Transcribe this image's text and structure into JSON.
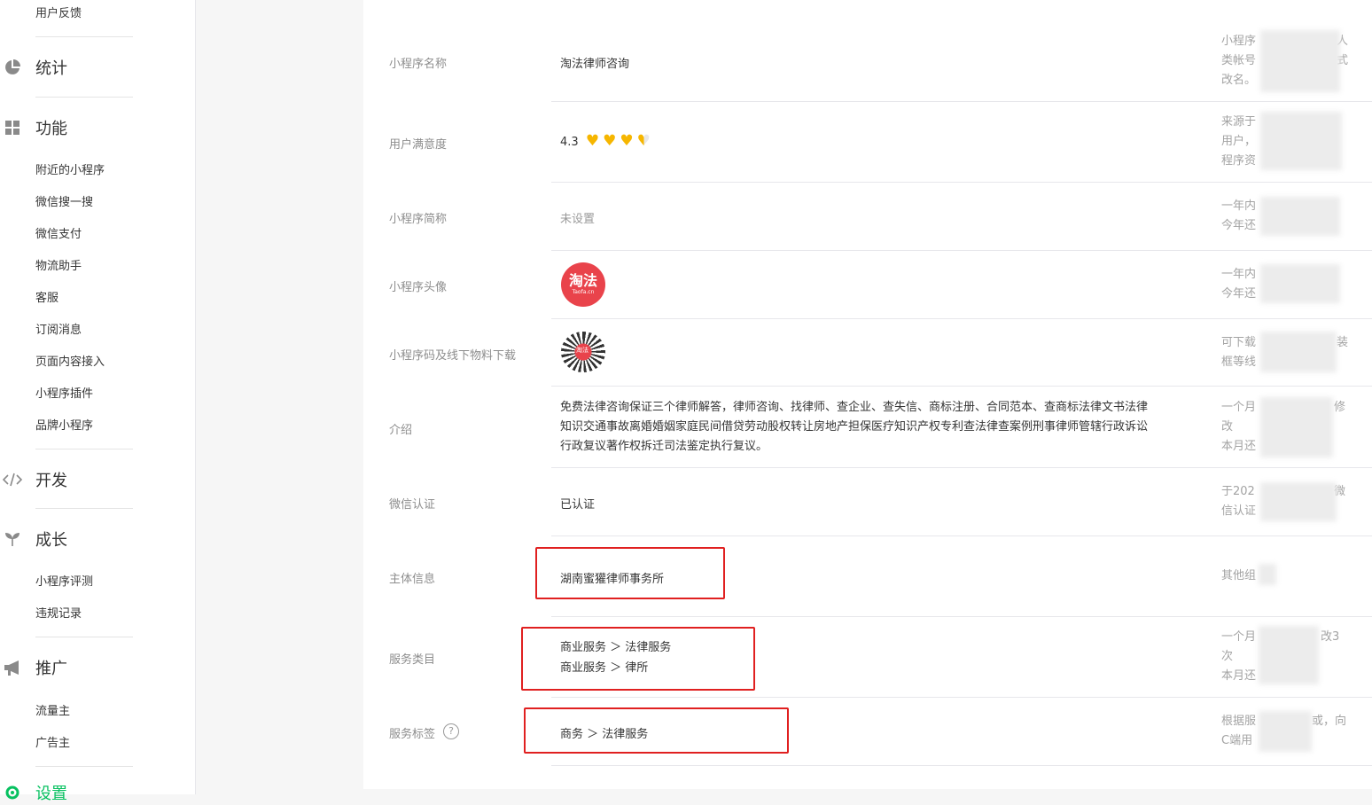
{
  "sidebar": {
    "feedback": "用户反馈",
    "stats": {
      "icon": "pie-chart-icon",
      "label": "统计"
    },
    "features": {
      "icon": "grid-icon",
      "label": "功能",
      "items": [
        "附近的小程序",
        "微信搜一搜",
        "微信支付",
        "物流助手",
        "客服",
        "订阅消息",
        "页面内容接入",
        "小程序插件",
        "品牌小程序"
      ]
    },
    "dev": {
      "icon": "code-icon",
      "label": "开发"
    },
    "growth": {
      "icon": "sprout-icon",
      "label": "成长",
      "items": [
        "小程序评测",
        "违规记录"
      ]
    },
    "promo": {
      "icon": "megaphone-icon",
      "label": "推广",
      "items": [
        "流量主",
        "广告主"
      ]
    },
    "settings": {
      "icon": "gear-icon",
      "label": "设置"
    }
  },
  "fields": {
    "name": {
      "label": "小程序名称",
      "value": "淘法律师咨询",
      "note": [
        "小程序",
        "类帐号",
        "改名。"
      ],
      "note_tail": [
        "人",
        "式"
      ]
    },
    "rating": {
      "label": "用户满意度",
      "value": "4.3",
      "stars": 3.5,
      "note": [
        "来源于",
        "用户，",
        "程序资"
      ]
    },
    "short": {
      "label": "小程序简称",
      "value": "未设置",
      "note": [
        "一年内",
        "今年还"
      ]
    },
    "avatar": {
      "label": "小程序头像",
      "logo_text": "淘法",
      "logo_sub": "Taofa.cn",
      "note": [
        "一年内",
        "今年还"
      ]
    },
    "qr": {
      "label": "小程序码及线下物料下载",
      "logo_text": "淘法",
      "note": [
        "可下载",
        "框等线"
      ],
      "note_tail": "装"
    },
    "intro": {
      "label": "介绍",
      "lines": [
        "免费法律咨询保证三个律师解答，律师咨询、找律师、查企业、查失信、商标注册、合同范本、查商标法律文书法律",
        "知识交通事故离婚婚姻家庭民间借贷劳动股权转让房地产担保医疗知识产权专利查法律查案例刑事律师管辖行政诉讼",
        "行政复议著作权拆迁司法鉴定执行复议。"
      ],
      "note": [
        "一个月",
        "改",
        "本月还"
      ],
      "note_tail": "修"
    },
    "wechat_cert": {
      "label": "微信认证",
      "value": "已认证",
      "note": [
        "于202",
        "信认证"
      ],
      "note_tail": "微"
    },
    "subject": {
      "label": "主体信息",
      "value": "湖南蜜獾律师事务所",
      "note": [
        "其他组"
      ]
    },
    "category": {
      "label": "服务类目",
      "values": [
        "商业服务 ＞ 法律服务",
        "商业服务 ＞ 律所"
      ],
      "note": [
        "一个月",
        "次",
        "本月还"
      ],
      "note_tail": "改3"
    },
    "tags": {
      "label": "服务标签",
      "help": "?",
      "value": "商务 ＞ 法律服务",
      "note": [
        "根据服",
        "C端用"
      ],
      "note_tail": "或，向"
    }
  }
}
